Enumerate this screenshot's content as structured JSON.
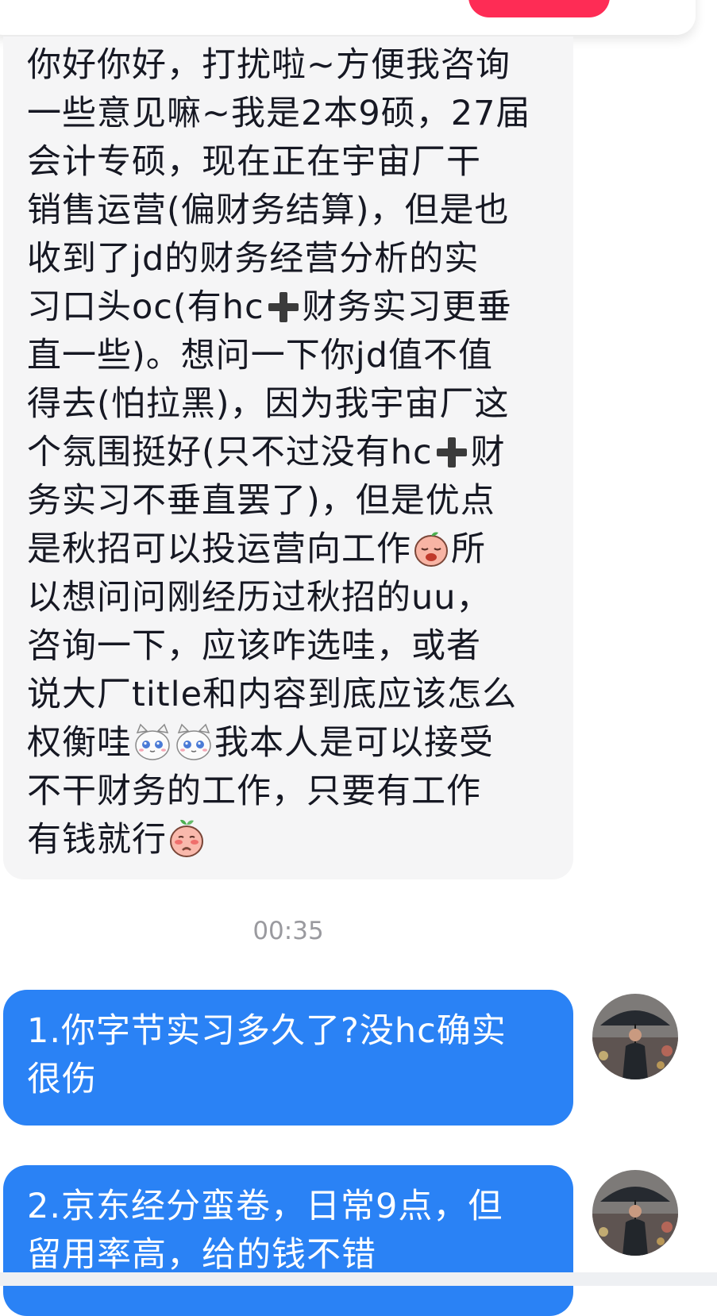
{
  "conversation": {
    "received_message": {
      "lines": [
        "你好你好，打扰啦~方便我咨询",
        "一些意见嘛~我是2本9硕，27届",
        "会计专硕，现在正在宇宙厂干",
        "销售运营(偏财务结算)，但是也",
        "收到了jd的财务经营分析的实",
        "习口头oc(有hc",
        "财务实习更垂",
        "直一些)。想问一下你jd值不值",
        "得去(怕拉黑)，因为我宇宙厂这",
        "个氛围挺好(只不过没有hc",
        "财",
        "务实习不垂直罢了)，但是优点",
        "是秋招可以投运营向工作",
        "所",
        "以想问问刚经历过秋招的uu，",
        "咨询一下，应该咋选哇，或者",
        "说大厂title和内容到底应该怎么",
        "权衡哇",
        "我本人是可以接受",
        "不干财务的工作，只要有工作",
        "有钱就行"
      ],
      "emojis": [
        "plus-emoji",
        "plus-emoji",
        "crying-peach-emoji",
        "teary-cat-emoji",
        "teary-cat-emoji",
        "shy-peach-emoji"
      ]
    },
    "timestamp": "00:35",
    "sent_messages": [
      {
        "lines": [
          "1.你字节实习多久了?没hc确实",
          "很伤"
        ]
      },
      {
        "lines": [
          "2.京东经分蛮卷，日常9点，但",
          "留用率高，给的钱不错"
        ]
      }
    ]
  },
  "colors": {
    "received_bubble": "#f5f5f6",
    "sent_bubble": "#2a82f5",
    "accent_red": "#fe2c55",
    "timestamp_text": "#9a9a9f"
  }
}
